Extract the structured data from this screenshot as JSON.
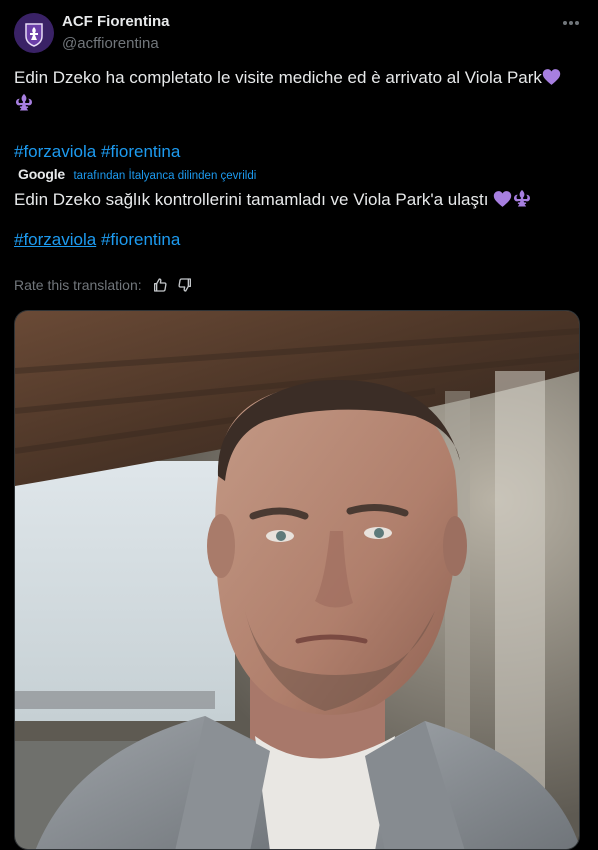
{
  "account": {
    "display_name": "ACF Fiorentina",
    "handle": "@acffiorentina"
  },
  "tweet": {
    "original_line_1": "Edin Dzeko ha completato le visite mediche ed è arrivato al Viola Park",
    "hashtags_original": [
      "#forzaviola",
      "#fiorentina"
    ],
    "translation_caption": "tarafından İtalyanca dilinden çevrildi",
    "translation_provider": "Google",
    "translated_line": "Edin Dzeko sağlık kontrollerini tamamladı ve Viola Park'a ulaştı",
    "hashtags_translated": [
      "#forzaviola",
      "#fiorentina"
    ],
    "rate_label": "Rate this translation:"
  },
  "icons": {
    "more": "more-horizontal-icon",
    "heart": "purple-heart-emoji",
    "fleur": "fleur-de-lis-emoji",
    "thumbs_up": "thumbs-up-icon",
    "thumbs_down": "thumbs-down-icon"
  },
  "colors": {
    "background": "#000000",
    "text": "#e7e9ea",
    "muted": "#71767b",
    "link": "#1d9bf0",
    "emoji_purple": "#a77fe0",
    "brand_purple": "#5b2c8f"
  },
  "media": {
    "alt": "photo"
  }
}
